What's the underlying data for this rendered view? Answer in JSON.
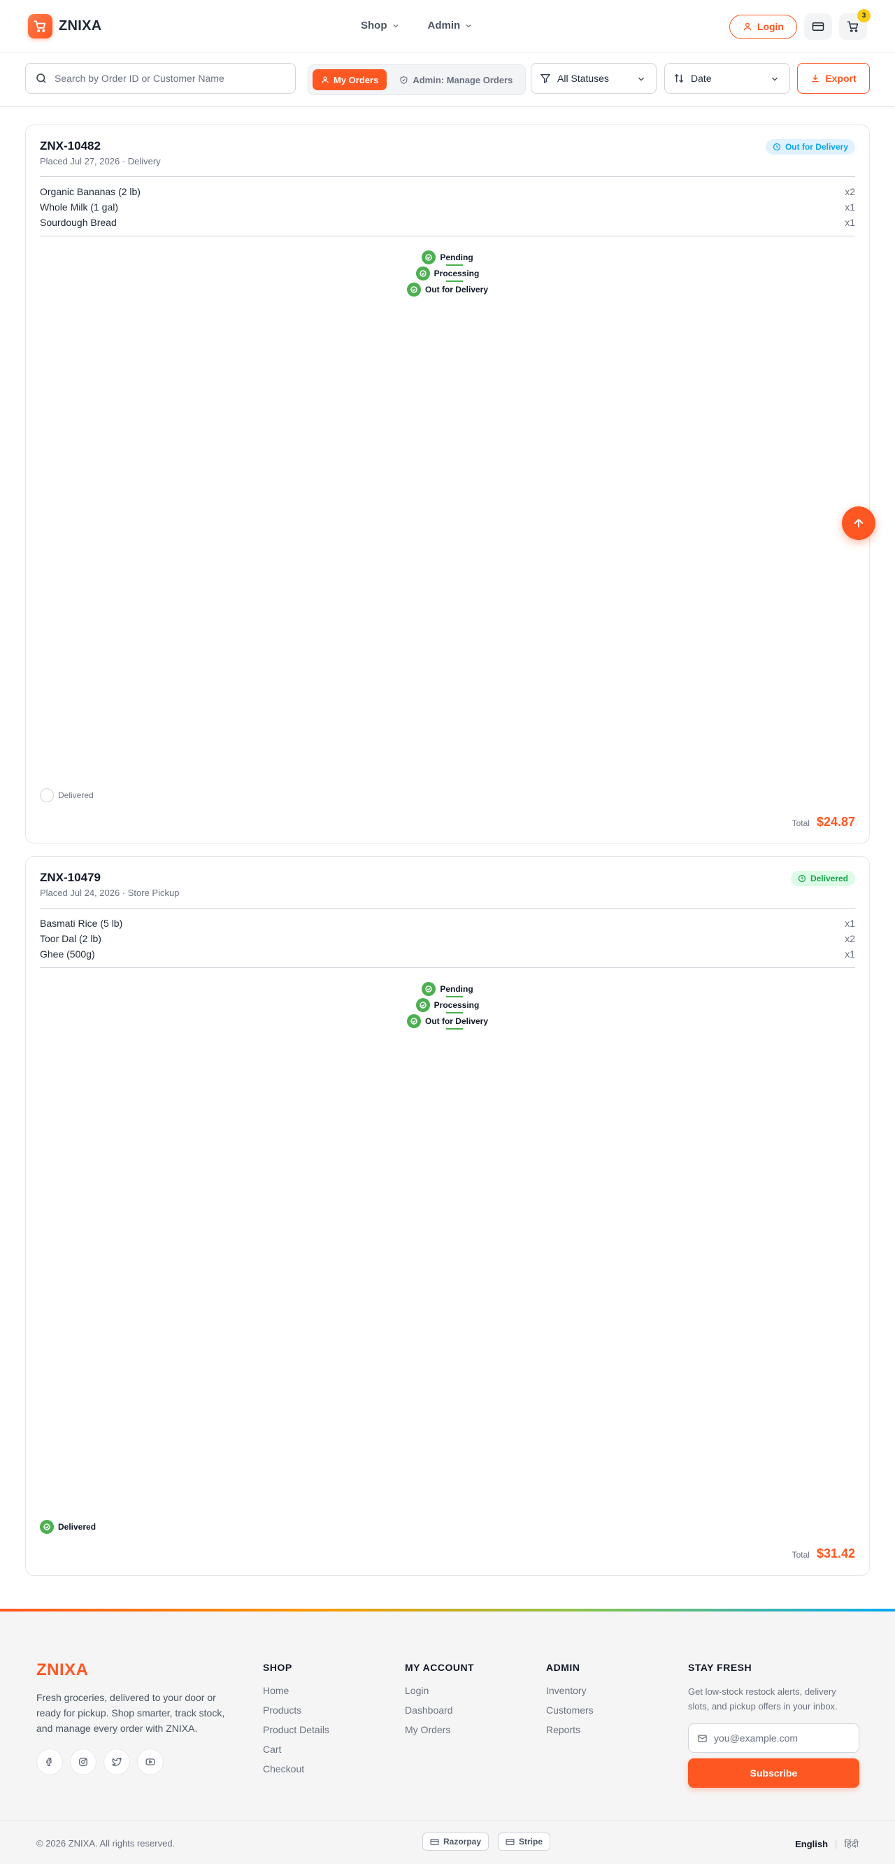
{
  "header": {
    "brand": "ZNIXA",
    "nav": [
      {
        "label": "Shop"
      },
      {
        "label": "Admin"
      }
    ],
    "login_label": "Login",
    "cart_count": "3"
  },
  "toolbar": {
    "search_placeholder": "Search by Order ID or Customer Name",
    "seg_my_orders": "My Orders",
    "seg_admin": "Admin: Manage Orders",
    "status_filter": "All Statuses",
    "sort": "Date",
    "export_label": "Export"
  },
  "orders": [
    {
      "id": "ZNX-10482",
      "meta": "Placed Jul 27, 2026 · Delivery",
      "status": "Out for Delivery",
      "status_color": "#0ea5e9",
      "items": [
        {
          "name": "Organic Bananas (2 lb)",
          "qty": "x2"
        },
        {
          "name": "Whole Milk (1 gal)",
          "qty": "x1"
        },
        {
          "name": "Sourdough Bread",
          "qty": "x1"
        }
      ],
      "steps": [
        "Pending",
        "Processing",
        "Out for Delivery"
      ],
      "final_step": "Delivered",
      "final_done": false,
      "total_label": "Total",
      "total": "$24.87"
    },
    {
      "id": "ZNX-10479",
      "meta": "Placed Jul 24, 2026 · Store Pickup",
      "status": "Delivered",
      "status_color": "#16a34a",
      "items": [
        {
          "name": "Basmati Rice (5 lb)",
          "qty": "x1"
        },
        {
          "name": "Toor Dal (2 lb)",
          "qty": "x2"
        },
        {
          "name": "Ghee (500g)",
          "qty": "x1"
        }
      ],
      "steps": [
        "Pending",
        "Processing",
        "Out for Delivery"
      ],
      "final_step": "Delivered",
      "final_done": true,
      "total_label": "Total",
      "total": "$31.42"
    }
  ],
  "footer": {
    "brand": "ZNIXA",
    "description": "Fresh groceries, delivered to your door or ready for pickup. Shop smarter, track stock, and manage every order with ZNIXA.",
    "socials": [
      "facebook-icon",
      "instagram-icon",
      "twitter-icon",
      "youtube-icon"
    ],
    "columns": [
      {
        "title": "SHOP",
        "links": [
          "Home",
          "Products",
          "Product Details",
          "Cart",
          "Checkout"
        ]
      },
      {
        "title": "MY ACCOUNT",
        "links": [
          "Login",
          "Dashboard",
          "My Orders"
        ]
      },
      {
        "title": "ADMIN",
        "links": [
          "Inventory",
          "Customers",
          "Reports"
        ]
      }
    ],
    "stay": {
      "title": "STAY FRESH",
      "desc": "Get low-stock restock alerts, delivery slots, and pickup offers in your inbox.",
      "placeholder": "you@example.com",
      "button": "Subscribe"
    },
    "copyright": "© 2026 ZNIXA. All rights reserved.",
    "payments": [
      "Razorpay",
      "Stripe"
    ],
    "languages": [
      "English",
      "हिंदी"
    ]
  },
  "colors": {
    "accent": "#ff5722",
    "success": "#4caf50"
  }
}
